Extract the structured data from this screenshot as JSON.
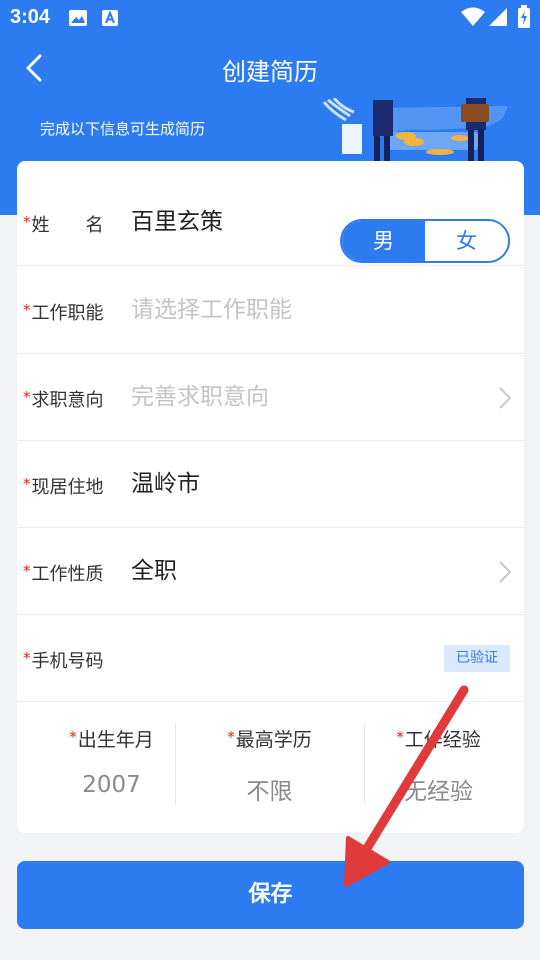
{
  "status_bar": {
    "time": "3:04",
    "left_icons": [
      "image-icon",
      "text-icon"
    ],
    "right_icons": [
      "wifi-icon",
      "signal-icon",
      "battery-icon"
    ]
  },
  "nav": {
    "title": "创建简历",
    "back_icon": "back-chevron-icon"
  },
  "header": {
    "hint": "完成以下信息可生成简历"
  },
  "form": {
    "required_mark": "*",
    "name": {
      "label": "姓　　名",
      "value": "百里玄策"
    },
    "gender": {
      "options": [
        "男",
        "女"
      ],
      "selected": "男"
    },
    "job_function": {
      "label": "工作职能",
      "placeholder": "请选择工作职能"
    },
    "job_intention": {
      "label": "求职意向",
      "placeholder": "完善求职意向"
    },
    "residence": {
      "label": "现居住地",
      "value": "温岭市"
    },
    "job_type": {
      "label": "工作性质",
      "value": "全职"
    },
    "phone": {
      "label": "手机号码",
      "badge": "已验证"
    },
    "birth": {
      "label": "出生年月",
      "value": "2007"
    },
    "education": {
      "label": "最高学历",
      "value": "不限"
    },
    "experience": {
      "label": "工作经验",
      "value": "无经验"
    }
  },
  "save_label": "保存",
  "colors": {
    "primary": "#2d7bf0",
    "required": "#e02020",
    "annotation_arrow": "#e03a3a"
  }
}
